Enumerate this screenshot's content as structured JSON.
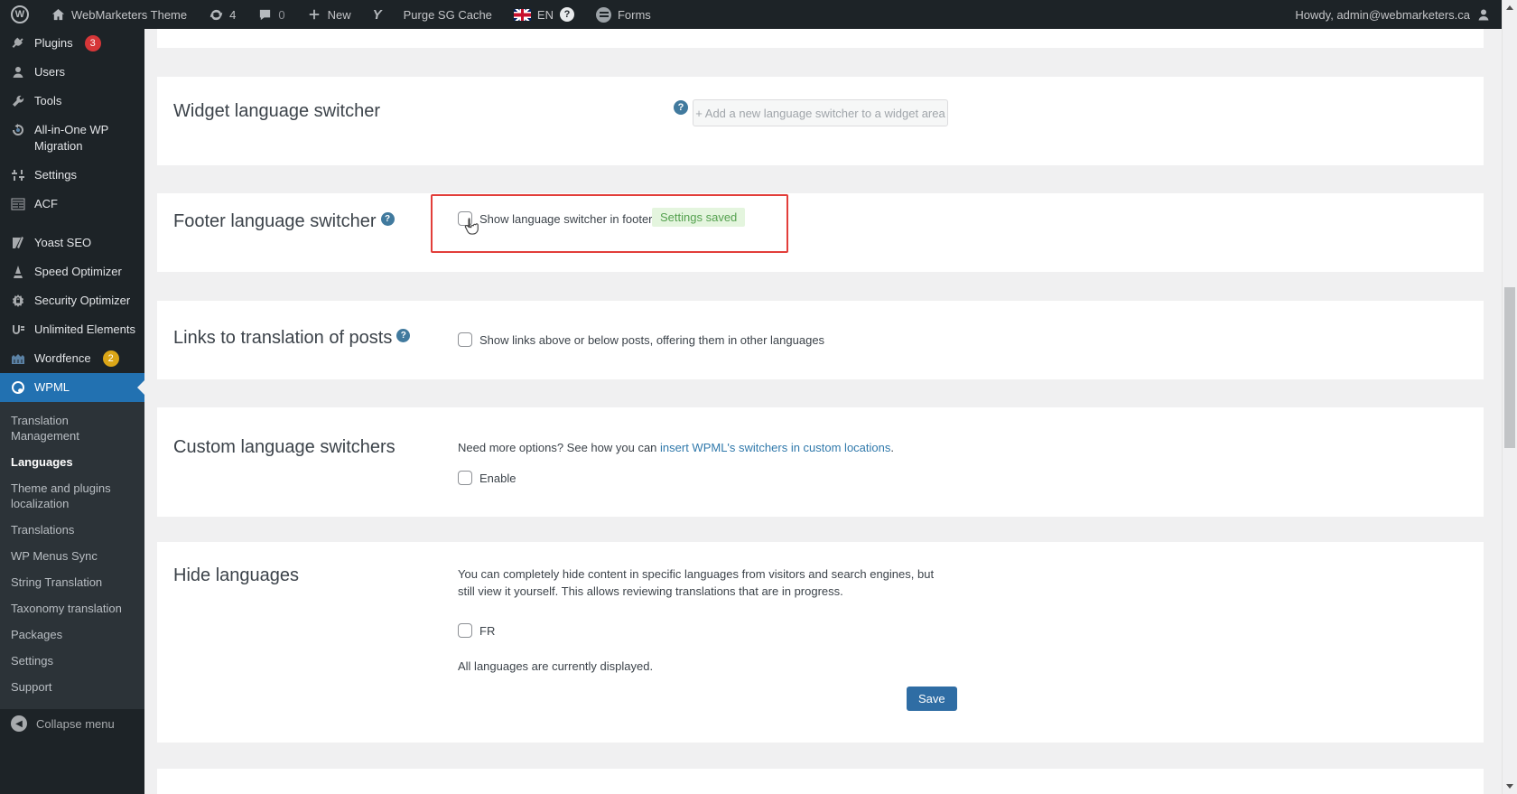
{
  "admin_bar": {
    "wp_logo": "W",
    "site_name": "WebMarketers Theme",
    "update_count": "4",
    "comment_count": "0",
    "new_label": "New",
    "yoast_label": "Y",
    "purge_label": "Purge SG Cache",
    "language_code": "EN",
    "language_help": "?",
    "forms_label": "Forms",
    "howdy": "Howdy, admin@webmarketers.ca"
  },
  "sidebar": {
    "items": [
      {
        "label": "Plugins",
        "badge": "3"
      },
      {
        "label": "Users"
      },
      {
        "label": "Tools"
      },
      {
        "label": "All-in-One WP Migration"
      },
      {
        "label": "Settings"
      },
      {
        "label": "ACF"
      },
      {
        "label": "Yoast SEO"
      },
      {
        "label": "Speed Optimizer"
      },
      {
        "label": "Security Optimizer"
      },
      {
        "label": "Unlimited Elements"
      },
      {
        "label": "Wordfence",
        "badge": "2"
      },
      {
        "label": "WPML"
      }
    ],
    "submenu": [
      "Translation Management",
      "Languages",
      "Theme and plugins localization",
      "Translations",
      "WP Menus Sync",
      "String Translation",
      "Taxonomy translation",
      "Packages",
      "Settings",
      "Support"
    ],
    "collapse_label": "Collapse menu"
  },
  "sections": {
    "widget": {
      "title": "Widget language switcher",
      "help": "?",
      "button_label": "+ Add a new language switcher to a widget area"
    },
    "footer": {
      "title": "Footer language switcher",
      "help": "?",
      "checkbox_label": "Show language switcher in footer",
      "saved_badge": "Settings saved"
    },
    "links": {
      "title": "Links to translation of posts",
      "help": "?",
      "checkbox_label": "Show links above or below posts, offering them in other languages"
    },
    "custom": {
      "title": "Custom language switchers",
      "text_before": "Need more options? See how you can ",
      "link_text": "insert WPML's switchers in custom locations",
      "text_after": ".",
      "checkbox_label": "Enable"
    },
    "hide": {
      "title": "Hide languages",
      "description": "You can completely hide content in specific languages from visitors and search engines, but still view it yourself. This allows reviewing translations that are in progress.",
      "checkbox_label": "FR",
      "status_text": "All languages are currently displayed.",
      "save_label": "Save"
    }
  },
  "colors": {
    "accent": "#2271b1",
    "admin_dark": "#1d2327",
    "highlight_red": "#e23e3a",
    "saved_bg": "#e4f5de",
    "saved_text": "#55a14f"
  }
}
